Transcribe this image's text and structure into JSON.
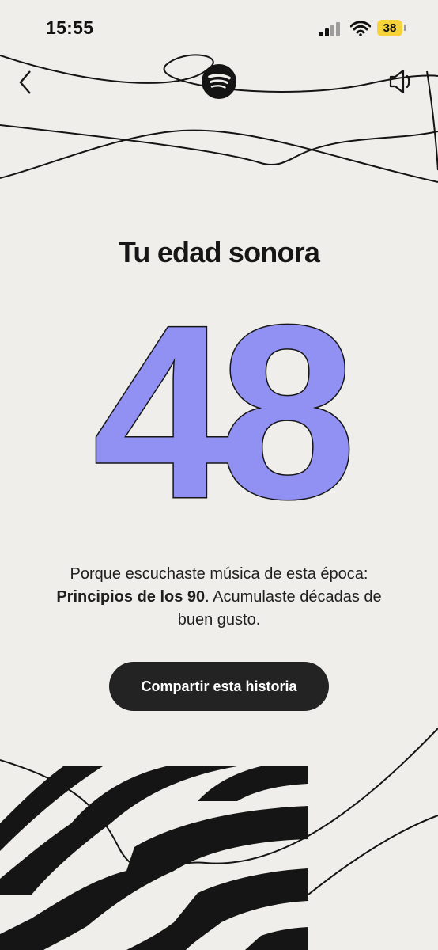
{
  "status_bar": {
    "time": "15:55",
    "battery_level": "38"
  },
  "header": {
    "logo": "spotify-logo",
    "back_icon": "chevron-left-icon",
    "sound_icon": "speaker-icon"
  },
  "story": {
    "title": "Tu edad sonora",
    "age": "48",
    "description_prefix": "Porque escuchaste música de esta época: ",
    "era": "Principios de los 90",
    "description_suffix": ". Acumulaste décadas de buen gusto.",
    "share_label": "Compartir esta historia"
  },
  "colors": {
    "background": "#efeeea",
    "number_fill": "#9190f3",
    "battery": "#f7d33a",
    "button": "#232323"
  }
}
